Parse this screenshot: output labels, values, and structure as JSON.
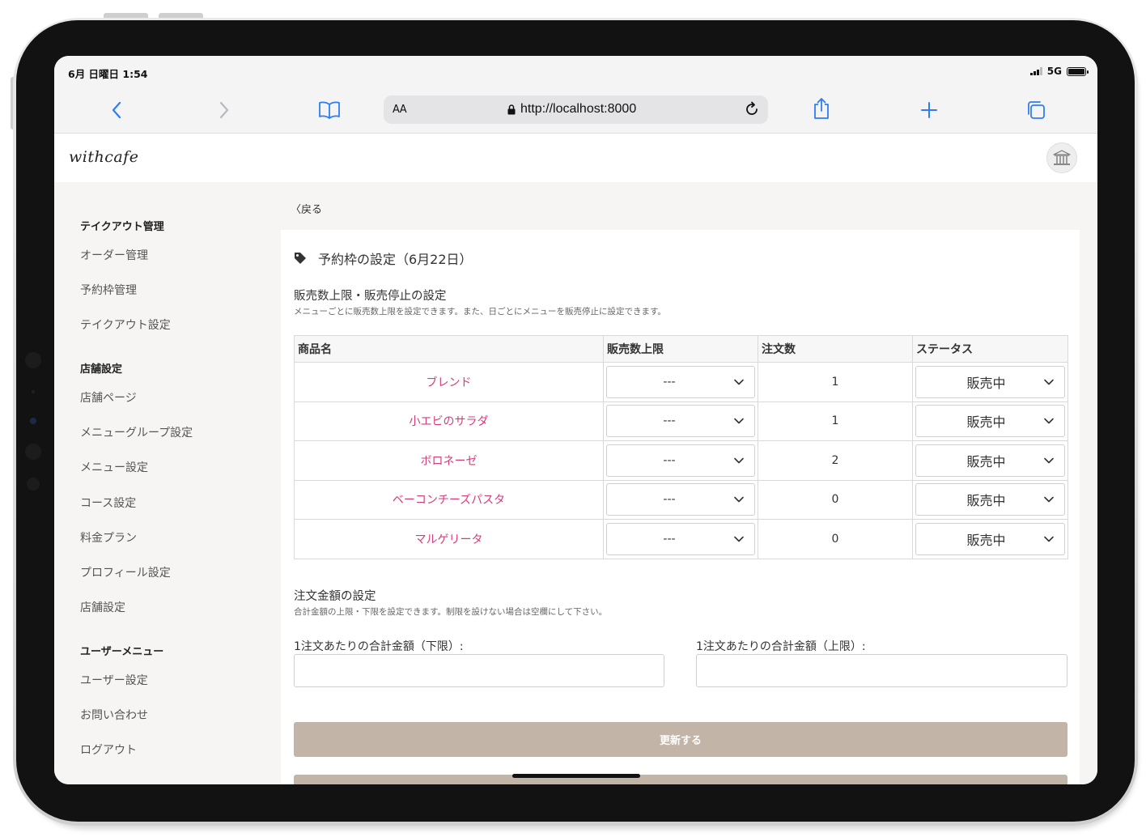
{
  "status_bar": {
    "time": "6月 日曜日 1:54",
    "network": "5G"
  },
  "browser": {
    "text_size_label": "AA",
    "url": "http://localhost:8000"
  },
  "app": {
    "logo": "withcafe"
  },
  "sidebar": {
    "groups": [
      {
        "title": "テイクアウト管理",
        "items": [
          "オーダー管理",
          "予約枠管理",
          "テイクアウト設定"
        ]
      },
      {
        "title": "店舗設定",
        "items": [
          "店舗ページ",
          "メニューグループ設定",
          "メニュー設定",
          "コース設定",
          "料金プラン",
          "プロフィール設定",
          "店舗設定"
        ]
      },
      {
        "title": "ユーザーメニュー",
        "items": [
          "ユーザー設定",
          "お問い合わせ",
          "ログアウト"
        ]
      }
    ]
  },
  "main": {
    "back_label": "戻る",
    "title": "予約枠の設定（6月22日）",
    "sales": {
      "title": "販売数上限・販売停止の設定",
      "description": "メニューごとに販売数上限を設定できます。また、日ごとにメニューを販売停止に設定できます。",
      "columns": [
        "商品名",
        "販売数上限",
        "注文数",
        "ステータス"
      ],
      "rows": [
        {
          "name": "ブレンド",
          "limit": "---",
          "orders": "1",
          "status": "販売中"
        },
        {
          "name": "小エビのサラダ",
          "limit": "---",
          "orders": "1",
          "status": "販売中"
        },
        {
          "name": "ボロネーゼ",
          "limit": "---",
          "orders": "2",
          "status": "販売中"
        },
        {
          "name": "ベーコンチーズパスタ",
          "limit": "---",
          "orders": "0",
          "status": "販売中"
        },
        {
          "name": "マルゲリータ",
          "limit": "---",
          "orders": "0",
          "status": "販売中"
        }
      ]
    },
    "amount": {
      "title": "注文金額の設定",
      "description": "合計金額の上限・下限を設定できます。制限を設けない場合は空欄にして下さい。",
      "min_label": "1注文あたりの合計金額（下限）:",
      "max_label": "1注文あたりの合計金額（上限）:",
      "min_value": "",
      "max_value": ""
    },
    "submit_label": "更新する"
  }
}
